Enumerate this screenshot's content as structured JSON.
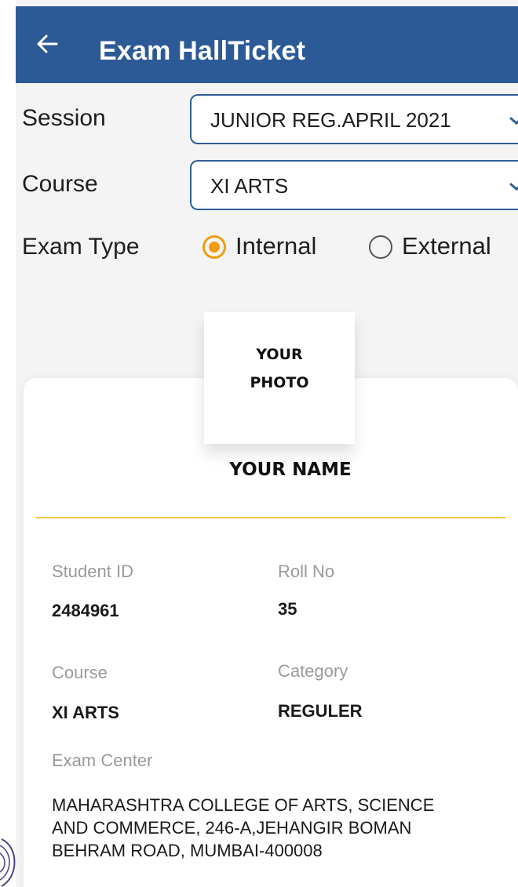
{
  "header": {
    "title": "Exam HallTicket",
    "back_icon": "arrow-left-icon"
  },
  "filters": {
    "session": {
      "label": "Session",
      "value": "JUNIOR REG.APRIL 2021"
    },
    "course": {
      "label": "Course",
      "value": "XI ARTS"
    },
    "exam_type": {
      "label": "Exam Type",
      "options": [
        {
          "label": "Internal",
          "selected": true
        },
        {
          "label": "External",
          "selected": false
        }
      ]
    }
  },
  "ticket": {
    "photo_placeholder": [
      "YOUR",
      "PHOTO"
    ],
    "name": "YOUR NAME",
    "student_id": {
      "label": "Student ID",
      "value": "2484961"
    },
    "roll_no": {
      "label": "Roll No",
      "value": "35"
    },
    "course": {
      "label": "Course",
      "value": "XI ARTS"
    },
    "category": {
      "label": "Category",
      "value": "REGULER"
    },
    "exam_center": {
      "label": "Exam Center",
      "lines": [
        "MAHARASHTRA COLLEGE OF ARTS, SCIENCE",
        "AND COMMERCE, 246-A,JEHANGIR BOMAN",
        "BEHRAM ROAD, MUMBAI-400008"
      ]
    }
  },
  "colors": {
    "appbar": "#2c5a97",
    "accent": "#f39c12",
    "divider": "#f2c53c"
  }
}
